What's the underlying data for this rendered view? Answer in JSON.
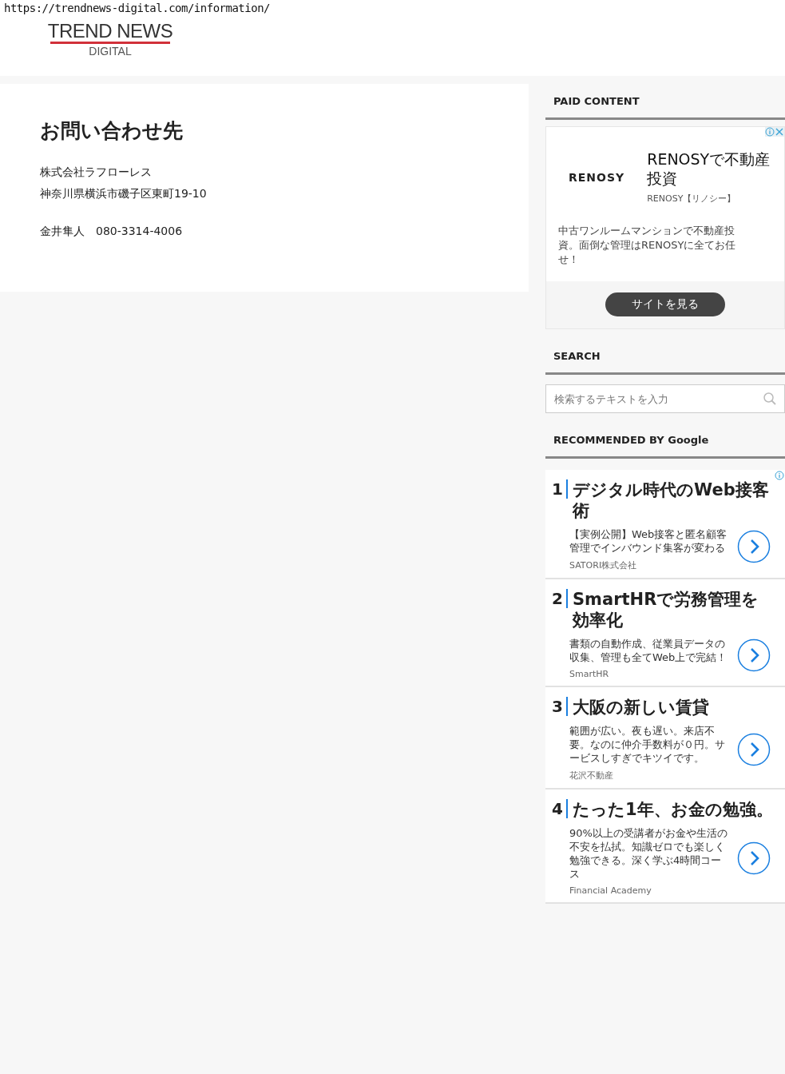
{
  "url": "https://trendnews-digital.com/information/",
  "logo": {
    "title": "TREND NEWS",
    "subtitle": "DIGITAL"
  },
  "article": {
    "title": "お問い合わせ先",
    "paragraphs": [
      [
        "株式会社ラフローレス",
        "神奈川県横浜市磯子区東町19-10"
      ],
      [
        "金井隼人　080-3314-4006"
      ]
    ]
  },
  "paid": {
    "heading": "PAID CONTENT",
    "ad": {
      "brand": "RENOSY",
      "title": "RENOSYで不動産投資",
      "source": "RENOSY【リノシー】",
      "body": "中古ワンルームマンションで不動産投資。面倒な管理はRENOSYに全てお任せ！",
      "button": "サイトを見る"
    }
  },
  "search": {
    "heading": "SEARCH",
    "placeholder": "検索するテキストを入力"
  },
  "recommended": {
    "heading": "RECOMMENDED BY Google",
    "items": [
      {
        "rank": "1",
        "title": "デジタル時代のWeb接客術",
        "body": "【実例公開】Web接客と匿名顧客管理でインバウンド集客が変わる",
        "source": "SATORI株式会社"
      },
      {
        "rank": "2",
        "title": "SmartHRで労務管理を効率化",
        "body": "書類の自動作成、従業員データの収集、管理も全てWeb上で完結！",
        "source": "SmartHR"
      },
      {
        "rank": "3",
        "title": "大阪の新しい賃貸",
        "body": "範囲が広い。夜も遅い。来店不要。なのに仲介手数料が０円。サービスしすぎでキツイです。",
        "source": "花沢不動産"
      },
      {
        "rank": "4",
        "title": "たった1年、お金の勉強。",
        "body": "90%以上の受講者がお金や生活の不安を払拭。知識ゼロでも楽しく勉強できる。深く学ぶ4時間コース",
        "source": "Financial Academy"
      }
    ]
  }
}
